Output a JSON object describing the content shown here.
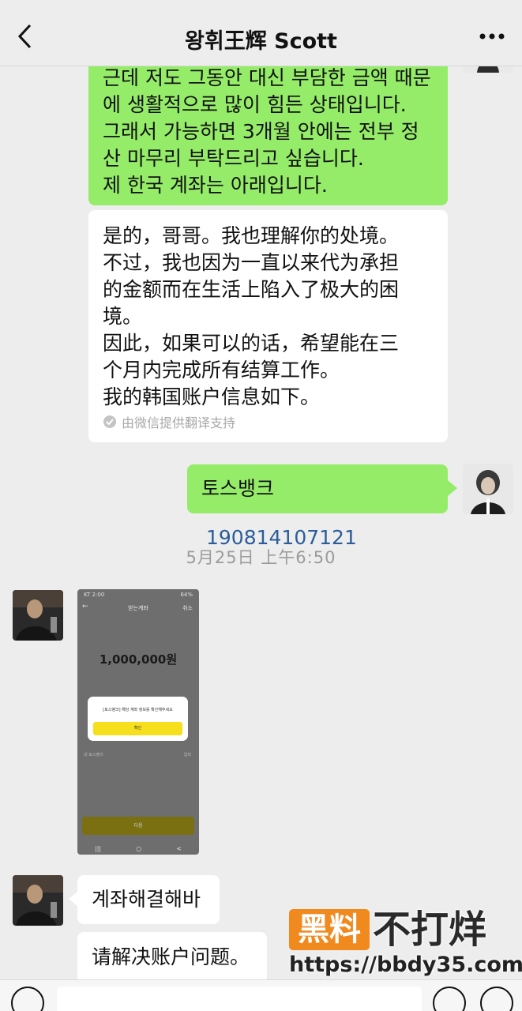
{
  "header": {
    "title": "왕휘王辉 Scott",
    "back_icon": "chevron-left-icon",
    "more_icon": "more-dots-icon"
  },
  "messages": {
    "korean_msg": {
      "lines": [
        "근데 저도 그동안 대신 부담한 금액 때문",
        "에 생활적으로 많이 힘든 상태입니다.",
        "그래서 가능하면 3개월 안에는 전부 정",
        "산 마무리 부탁드리고 싶습니다.",
        "제 한국 계좌는 아래입니다."
      ]
    },
    "translation_msg": {
      "lines": [
        "是的，哥哥。我也理解你的处境。",
        "不过，我也因为一直以来代为承担",
        "的金额而在生活上陷入了极大的困",
        "境。",
        "因此，如果可以的话，希望能在三",
        "个月内完成所有结算工作。",
        "我的韩国账户信息如下。"
      ],
      "note": "由微信提供翻译支持"
    },
    "account_msg": {
      "bank": "토스뱅크",
      "number": "190814107121"
    },
    "timestamp": "5月25日 上午6:50",
    "phone_screenshot": {
      "status_left": "KT 2:00",
      "status_right": "64%",
      "header": "받는계좌",
      "cancel": "취소",
      "amount": "1,000,000원",
      "dialog_text": "[토스뱅크] 해당 계좌 정보를 확인해주세요",
      "dialog_button": "확인",
      "small_left": "내 토스뱅크",
      "small_right": "입력",
      "bottom_button": "다음"
    },
    "reply_msg": "계좌해결해바",
    "reply_translation": "请解决账户问题。"
  },
  "watermark": {
    "box_text": "黑料",
    "text": "不打烊",
    "url": "https://bbdy35.com"
  },
  "colors": {
    "background": "#ededed",
    "sent_bubble": "#95ec69",
    "received_bubble": "#ffffff",
    "account_number": "#2a5d9a",
    "watermark_orange": "#f08a1e"
  }
}
